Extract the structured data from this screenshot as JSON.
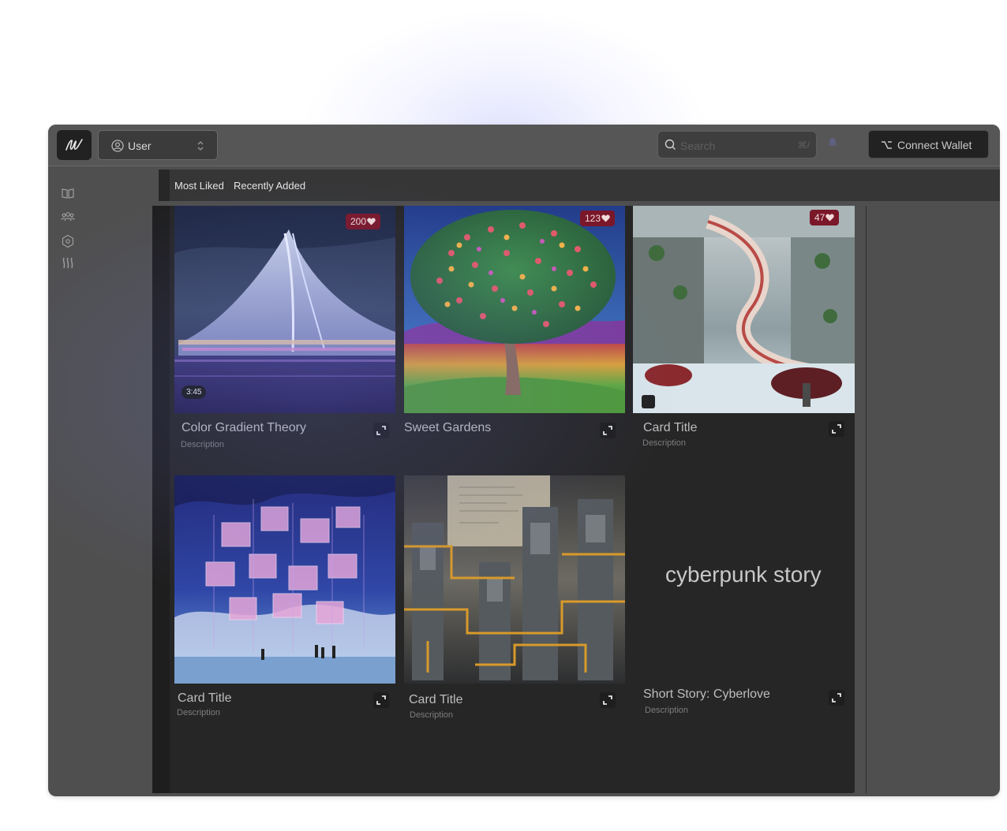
{
  "header": {
    "user_label": "User",
    "search_placeholder": "Search",
    "search_shortcut": "⌘/",
    "connect_wallet_label": "Connect Wallet"
  },
  "tabs": [
    {
      "label": "Most Liked"
    },
    {
      "label": "Recently Added"
    }
  ],
  "sidebar": {
    "items": [
      {
        "icon": "book-icon"
      },
      {
        "icon": "users-icon"
      },
      {
        "icon": "hexagon-icon"
      },
      {
        "icon": "flame-icon"
      }
    ]
  },
  "cards": [
    {
      "title": "Color Gradient Theory",
      "description": "Description",
      "likes": "200",
      "duration": "3:45"
    },
    {
      "title": "Sweet Gardens",
      "description": "",
      "likes": "123"
    },
    {
      "title": "Card Title",
      "description": "Description",
      "likes": "47"
    },
    {
      "title": "Card Title",
      "description": "Description"
    },
    {
      "title": "Card Title",
      "description": "Description"
    },
    {
      "title": "Short Story: Cyberlove",
      "description": "Description",
      "story_text": "cyberpunk story"
    }
  ],
  "colors": {
    "badge": "#7a1729",
    "window": "#4f4f4f",
    "content": "#262626"
  }
}
